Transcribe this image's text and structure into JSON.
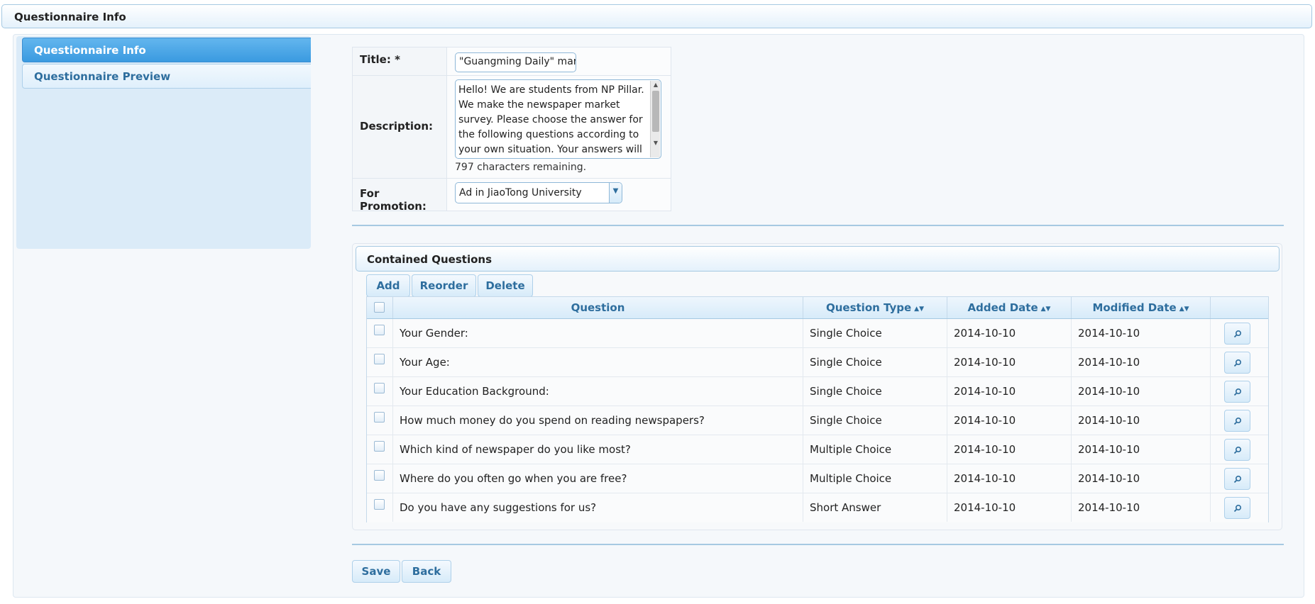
{
  "header": {
    "title": "Questionnaire Info"
  },
  "sidebar": {
    "items": [
      {
        "label": "Questionnaire Info",
        "active": true
      },
      {
        "label": "Questionnaire Preview",
        "active": false
      }
    ]
  },
  "form": {
    "title_label": "Title: *",
    "title_value": "\"Guangming Daily\" market survey",
    "description_label": "Description:",
    "description_value": "Hello! We are students from NP Pillar. We make the newspaper market survey. Please choose the answer for the following questions according to your own situation. Your answers will",
    "chars_remaining": "797 characters remaining.",
    "promotion_label": "For Promotion:",
    "promotion_value": "Ad in JiaoTong University"
  },
  "questions": {
    "title": "Contained Questions",
    "toolbar": {
      "add": "Add",
      "reorder": "Reorder",
      "delete": "Delete"
    },
    "columns": {
      "question": "Question",
      "type": "Question Type",
      "added": "Added Date",
      "modified": "Modified Date"
    },
    "rows": [
      {
        "question": "Your Gender:",
        "type": "Single Choice",
        "added": "2014-10-10",
        "modified": "2014-10-10"
      },
      {
        "question": "Your Age:",
        "type": "Single Choice",
        "added": "2014-10-10",
        "modified": "2014-10-10"
      },
      {
        "question": "Your Education Background:",
        "type": "Single Choice",
        "added": "2014-10-10",
        "modified": "2014-10-10"
      },
      {
        "question": "How much money do you spend on reading newspapers?",
        "type": "Single Choice",
        "added": "2014-10-10",
        "modified": "2014-10-10"
      },
      {
        "question": "Which kind of newspaper do you like most?",
        "type": "Multiple Choice",
        "added": "2014-10-10",
        "modified": "2014-10-10"
      },
      {
        "question": "Where do you often go when you are free?",
        "type": "Multiple Choice",
        "added": "2014-10-10",
        "modified": "2014-10-10"
      },
      {
        "question": "Do you have any suggestions for us?",
        "type": "Short Answer",
        "added": "2014-10-10",
        "modified": "2014-10-10"
      }
    ]
  },
  "actions": {
    "save": "Save",
    "back": "Back"
  },
  "icons": {
    "sort": "sort-icon",
    "view": "search-icon",
    "dropdown": "chevron-down-icon"
  },
  "colors": {
    "accent": "#2e6e9e",
    "active_tab": "#3a9ae0",
    "border": "#a6c9e2"
  }
}
